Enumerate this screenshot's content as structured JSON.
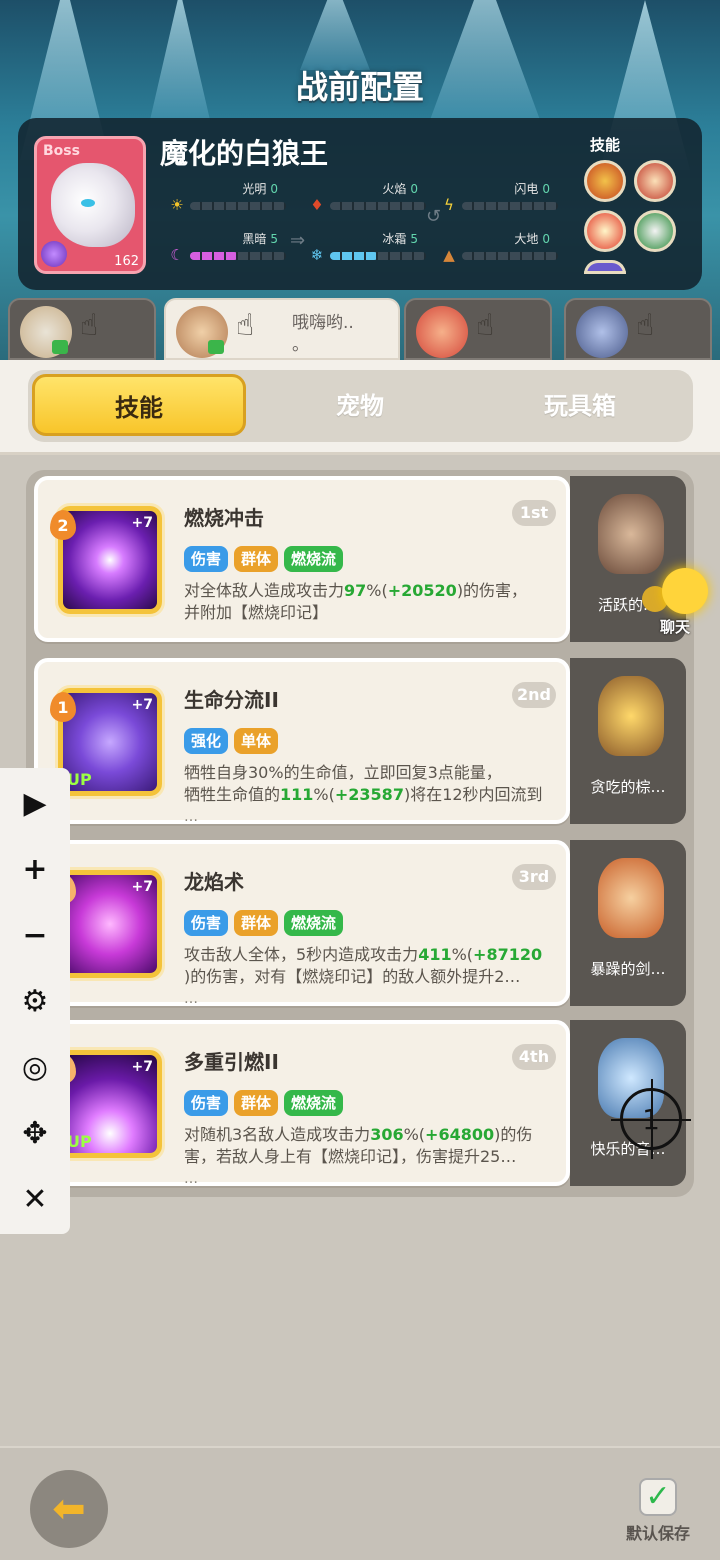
{
  "title": "战前配置",
  "boss": {
    "tag": "Boss",
    "name": "魔化的白狼王",
    "level": "162",
    "elements": [
      {
        "name": "光明",
        "value": "0",
        "icon": "sun-icon",
        "glyph": "☀",
        "color": "#f5c52a",
        "fill": 0
      },
      {
        "name": "火焰",
        "value": "0",
        "icon": "fire-icon",
        "glyph": "🔥",
        "color": "#e04a2a",
        "fill": 0
      },
      {
        "name": "闪电",
        "value": "0",
        "icon": "lightning-icon",
        "glyph": "⚡",
        "color": "#f7d23a",
        "fill": 0
      },
      {
        "name": "黑暗",
        "value": "5",
        "icon": "moon-icon",
        "glyph": "☾",
        "color": "#d65fe0",
        "fill": 0.5
      },
      {
        "name": "冰霜",
        "value": "5",
        "icon": "snowflake-icon",
        "glyph": "❄",
        "color": "#5fc6f0",
        "fill": 0.5
      },
      {
        "name": "大地",
        "value": "0",
        "icon": "earth-icon",
        "glyph": "▲",
        "color": "#d6863a",
        "fill": 0
      }
    ],
    "skills_label": "技能"
  },
  "players": [
    {
      "chat": "",
      "avatar_color": "#c9b08a"
    },
    {
      "chat": "哦嗨哟..\n。",
      "avatar_color": "#b37c53"
    },
    {
      "chat": "",
      "avatar_color": "#d4473a"
    },
    {
      "chat": "",
      "avatar_color": "#4a5a8a"
    }
  ],
  "tabs": [
    "技能",
    "宠物",
    "玩具箱"
  ],
  "skills": [
    {
      "title": "燃烧冲击",
      "rank": "1st",
      "level": "2",
      "plus": "+7",
      "up": "",
      "tags": [
        {
          "text": "伤害",
          "color": "#3a9be8"
        },
        {
          "text": "群体",
          "color": "#eaa12a"
        },
        {
          "text": "燃烧流",
          "color": "#35b84a"
        }
      ],
      "desc1_a": "对全体敌人造成攻击力",
      "desc1_g": "97",
      "desc1_b": "%(",
      "desc1_g2": "+20520",
      "desc1_c": ")的伤害，",
      "desc2": "并附加【燃烧印记】",
      "dots": "",
      "pet": "活跃的…",
      "pet_color": "#6a4a3a"
    },
    {
      "title": "生命分流II",
      "rank": "2nd",
      "level": "1",
      "plus": "+7",
      "up": "UP",
      "tags": [
        {
          "text": "强化",
          "color": "#3a9be8"
        },
        {
          "text": "单体",
          "color": "#eaa12a"
        }
      ],
      "desc1_a": "牺牲自身30%的生命值，立即回复3点能量，",
      "desc1_g": "",
      "desc1_b": "",
      "desc1_g2": "",
      "desc1_c": "",
      "desc2_a": "牺牲生命值的",
      "desc2_g": "111",
      "desc2_b": "%(",
      "desc2_g2": "+23587",
      "desc2_c": ")将在12秒内回流到",
      "dots": "…",
      "pet": "贪吃的棕…",
      "pet_color": "#e9a83a"
    },
    {
      "title": "龙焰术",
      "rank": "3rd",
      "level": "3",
      "plus": "+7",
      "up": "",
      "tags": [
        {
          "text": "伤害",
          "color": "#3a9be8"
        },
        {
          "text": "群体",
          "color": "#eaa12a"
        },
        {
          "text": "燃烧流",
          "color": "#35b84a"
        }
      ],
      "desc1_a": "攻击敌人全体，5秒内造成攻击力",
      "desc1_g": "411",
      "desc1_b": "%(",
      "desc1_g2": "+87120",
      "desc1_c": "",
      "desc2": ")的伤害，对有【燃烧印记】的敌人额外提升2…",
      "dots": "…",
      "pet": "暴躁的剑…",
      "pet_color": "#e07a2a"
    },
    {
      "title": "多重引燃II",
      "rank": "4th",
      "level": "3",
      "plus": "+7",
      "up": "UP",
      "tags": [
        {
          "text": "伤害",
          "color": "#3a9be8"
        },
        {
          "text": "群体",
          "color": "#eaa12a"
        },
        {
          "text": "燃烧流",
          "color": "#35b84a"
        }
      ],
      "desc1_a": "对随机3名敌人造成攻击力",
      "desc1_g": "306",
      "desc1_b": "%(",
      "desc1_g2": "+64800",
      "desc1_c": ")的伤",
      "desc2": "害，若敌人身上有【燃烧印记】，伤害提升25…",
      "dots": "…",
      "pet": "快乐的音…",
      "pet_color": "#6ab6e0"
    }
  ],
  "chat_label": "聊天",
  "crosshair_number": "1",
  "save_label": "默认保存",
  "colors": {
    "accent": "#f8c52a",
    "green": "#27a834",
    "panel": "#f5f0e6"
  }
}
